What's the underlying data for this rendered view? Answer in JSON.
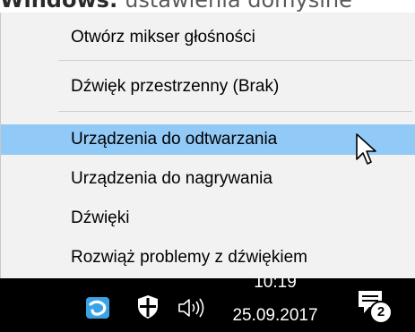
{
  "page_heading": {
    "bold_part": "Windows:",
    "light_part": " ustawienia domyślne"
  },
  "context_menu": {
    "items": [
      {
        "label": "Otwórz mikser głośności"
      },
      {
        "label": "Dźwięk przestrzenny (Brak)"
      },
      {
        "label": "Urządzenia do odtwarzania",
        "highlighted": true
      },
      {
        "label": "Urządzenia do nagrywania"
      },
      {
        "label": "Dźwięki"
      },
      {
        "label": "Rozwiąż problemy z dźwiękiem"
      }
    ],
    "highlight_color": "#91c9f7"
  },
  "taskbar": {
    "icons": [
      "app-tray-icon",
      "shield-icon",
      "speaker-icon",
      "notification-icon"
    ],
    "clock": {
      "time": "10:19",
      "date": "25.09.2017"
    },
    "notification_count": "2"
  }
}
